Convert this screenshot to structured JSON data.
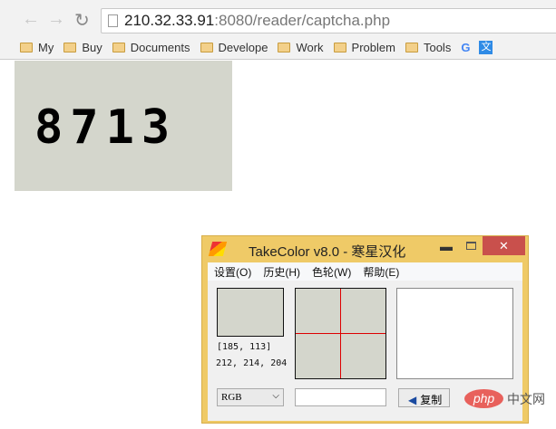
{
  "browser": {
    "url_host": "210.32.33.91",
    "url_rest": ":8080/reader/captcha.php",
    "bookmarks": [
      "My",
      "Buy",
      "Documents",
      "Develope",
      "Work",
      "Problem",
      "Tools"
    ],
    "icons": [
      "back-icon",
      "forward-icon",
      "reload-icon",
      "google-icon",
      "translate-icon"
    ]
  },
  "captcha": {
    "text": "8713"
  },
  "takecolor": {
    "title": "TakeColor v8.0 - 寒星汉化",
    "menu": [
      "设置(O)",
      "历史(H)",
      "色轮(W)",
      "帮助(E)"
    ],
    "coords": "[185, 113]",
    "rgb": "212, 214, 204",
    "swatch_color": "#d4d6cc",
    "mode": "RGB",
    "hex_value": "",
    "copy_label": "复制"
  },
  "watermark": {
    "logo": "php",
    "text": "中文网"
  }
}
